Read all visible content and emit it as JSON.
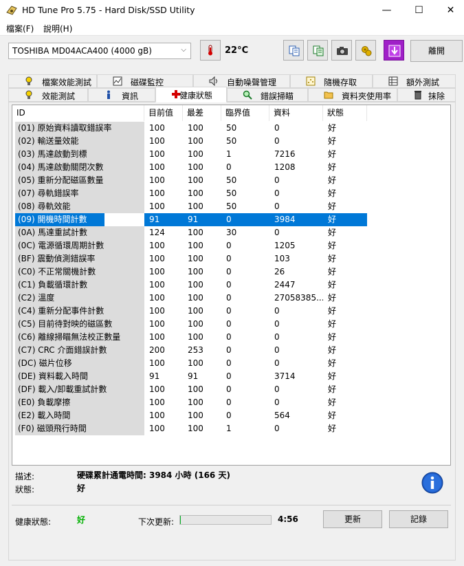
{
  "window": {
    "title": "HD Tune Pro 5.75 - Hard Disk/SSD Utility"
  },
  "menu": {
    "items": [
      "檔案(F)",
      "說明(H)"
    ]
  },
  "toolbar": {
    "drive": "TOSHIBA MD04ACA400 (4000 gB)",
    "temperature": "22°C",
    "exit_label": "離開"
  },
  "tabs": {
    "row1": [
      "檔案效能測試",
      "磁碟監控",
      "自動噪聲管理",
      "隨機存取",
      "額外測試"
    ],
    "row2": [
      "效能測試",
      "資訊",
      "健康狀態",
      "錯誤掃瞄",
      "資料夾使用率",
      "抹除"
    ],
    "active": "健康狀態"
  },
  "table": {
    "columns": [
      "ID",
      "目前值",
      "最差",
      "臨界值",
      "資料",
      "狀態"
    ],
    "rows": [
      [
        "(01) 原始資料讀取錯誤率",
        "100",
        "100",
        "50",
        "0",
        "好"
      ],
      [
        "(02) 輸送量效能",
        "100",
        "100",
        "50",
        "0",
        "好"
      ],
      [
        "(03) 馬達啟動到標",
        "100",
        "100",
        "1",
        "7216",
        "好"
      ],
      [
        "(04) 馬達啟動關閉次數",
        "100",
        "100",
        "0",
        "1208",
        "好"
      ],
      [
        "(05) 重新分配磁區數量",
        "100",
        "100",
        "50",
        "0",
        "好"
      ],
      [
        "(07) 尋軌錯誤率",
        "100",
        "100",
        "50",
        "0",
        "好"
      ],
      [
        "(08) 尋軌效能",
        "100",
        "100",
        "50",
        "0",
        "好"
      ],
      [
        "(09) 開機時間計數",
        "91",
        "91",
        "0",
        "3984",
        "好"
      ],
      [
        "(0A) 馬達重試計數",
        "124",
        "100",
        "30",
        "0",
        "好"
      ],
      [
        "(0C) 電源循環周期計數",
        "100",
        "100",
        "0",
        "1205",
        "好"
      ],
      [
        "(BF) 震動偵測錯誤率",
        "100",
        "100",
        "0",
        "103",
        "好"
      ],
      [
        "(C0) 不正常關機計數",
        "100",
        "100",
        "0",
        "26",
        "好"
      ],
      [
        "(C1) 負載循環計數",
        "100",
        "100",
        "0",
        "2447",
        "好"
      ],
      [
        "(C2) 溫度",
        "100",
        "100",
        "0",
        "27058385...",
        "好"
      ],
      [
        "(C4) 重新分配事件計數",
        "100",
        "100",
        "0",
        "0",
        "好"
      ],
      [
        "(C5) 目前待對映的磁區數",
        "100",
        "100",
        "0",
        "0",
        "好"
      ],
      [
        "(C6) 離線掃瞄無法校正數量",
        "100",
        "100",
        "0",
        "0",
        "好"
      ],
      [
        "(C7) CRC 介面錯誤計數",
        "200",
        "253",
        "0",
        "0",
        "好"
      ],
      [
        "(DC) 磁片位移",
        "100",
        "100",
        "0",
        "0",
        "好"
      ],
      [
        "(DE) 資料載入時間",
        "91",
        "91",
        "0",
        "3714",
        "好"
      ],
      [
        "(DF) 載入/卸載重試計數",
        "100",
        "100",
        "0",
        "0",
        "好"
      ],
      [
        "(E0) 負載摩擦",
        "100",
        "100",
        "0",
        "0",
        "好"
      ],
      [
        "(E2) 載入時間",
        "100",
        "100",
        "0",
        "564",
        "好"
      ],
      [
        "(F0) 磁頭飛行時間",
        "100",
        "100",
        "1",
        "0",
        "好"
      ]
    ],
    "selected_index": 7
  },
  "description": {
    "desc_label": "描述:",
    "desc_value": "硬碟累計通電時間: 3984 小時 (166 天)",
    "status_label": "狀態:",
    "status_value": "好"
  },
  "footer": {
    "health_label": "健康狀態:",
    "health_value": "好",
    "next_update_label": "下次更新:",
    "countdown": "4:56",
    "progress_fraction": 0.01,
    "refresh_label": "更新",
    "log_label": "記錄"
  },
  "colors": {
    "selection": "#0078d7",
    "health_ok": "#00b000"
  }
}
